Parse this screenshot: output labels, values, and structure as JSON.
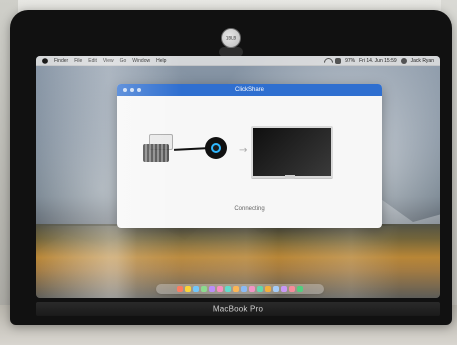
{
  "photo": {
    "laptop_brand_label": "MacBook Pro",
    "camera_label": "1BLB"
  },
  "macos": {
    "menubar": {
      "items": [
        "Finder",
        "File",
        "Edit",
        "View",
        "Go",
        "Window",
        "Help"
      ],
      "status": {
        "battery": "97%",
        "date_time": "Fri 14. Jun 15:59",
        "user": "Jack Ryan"
      }
    },
    "app": {
      "title": "ClickShare",
      "status_text": "Connecting"
    },
    "dock": {
      "icon_colors": [
        "#ff5a36",
        "#ffcc00",
        "#49b9ff",
        "#6ad46f",
        "#a86bff",
        "#ff6bb0",
        "#2dd4bf",
        "#ff9f1a",
        "#60a5fa",
        "#f472b6",
        "#34d399",
        "#f59e0b",
        "#93c5fd",
        "#c084fc",
        "#fb7185",
        "#22c55e"
      ]
    }
  },
  "icons": {
    "apple": "apple-logo-icon",
    "wifi": "wifi-icon",
    "battery": "battery-icon",
    "user": "user-icon",
    "close": "close-dot-icon",
    "minimize": "minimize-dot-icon",
    "zoom": "zoom-dot-icon",
    "laptop": "laptop-icon",
    "dongle": "clickshare-button-icon",
    "display": "monitor-icon",
    "arrow": "right-arrow-icon"
  },
  "colors": {
    "titlebar_blue": "#2f6fd0",
    "dongle_ring": "#2fb8ff"
  }
}
